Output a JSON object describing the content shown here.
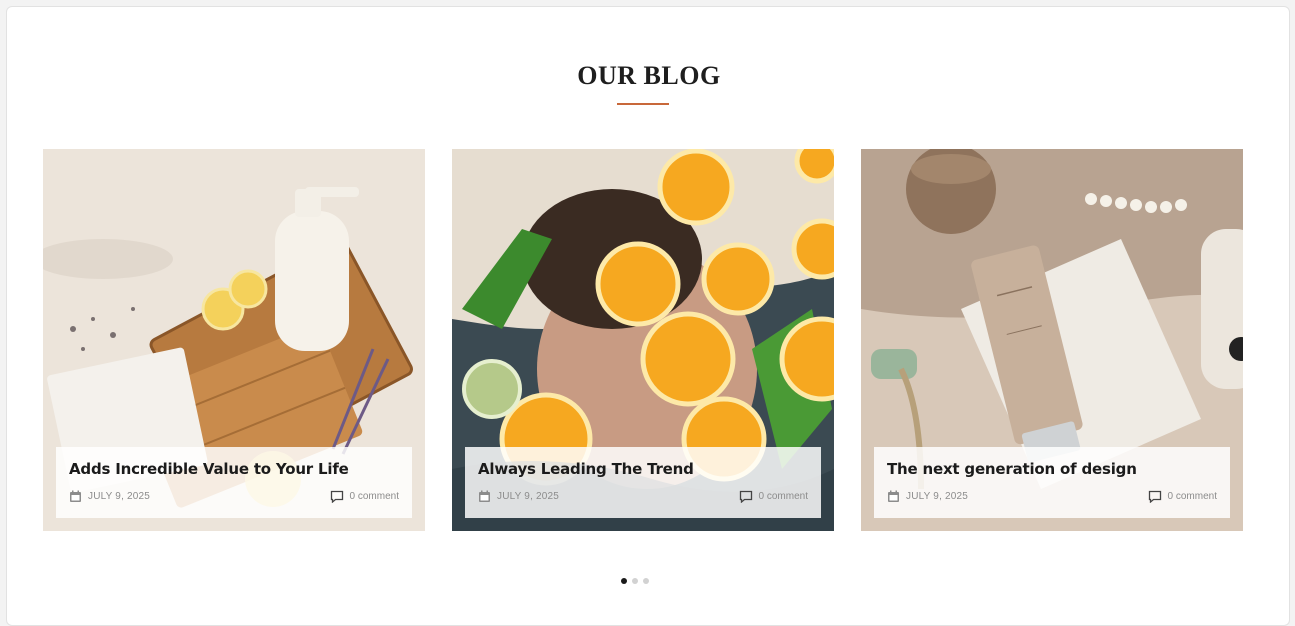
{
  "section": {
    "title": "OUR BLOG",
    "accent_color": "#c8683a"
  },
  "posts": [
    {
      "title": "Adds Incredible Value to Your Life",
      "date": "JULY 9, 2025",
      "comments": "0 comment",
      "image_icon": "skincare-bottle-on-wooden-board-photo"
    },
    {
      "title": "Always Leading The Trend",
      "date": "JULY 9, 2025",
      "comments": "0 comment",
      "image_icon": "orange-slices-in-water-photo"
    },
    {
      "title": "The next generation of design",
      "date": "JULY 9, 2025",
      "comments": "0 comment",
      "image_icon": "cosmetic-tube-and-face-roller-photo"
    }
  ],
  "carousel": {
    "pages": 3,
    "active_page": 1
  }
}
